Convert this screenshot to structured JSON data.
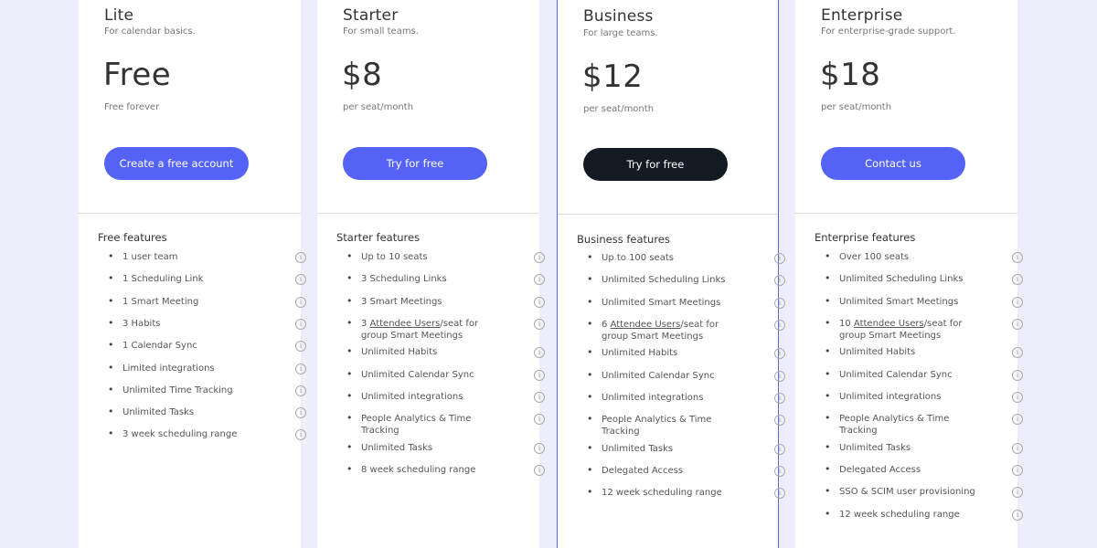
{
  "plans": [
    {
      "name": "Lite",
      "description": "For calendar basics.",
      "price": "Free",
      "billing": "Free forever",
      "cta": "Create a free account",
      "features_title": "Free features",
      "features": [
        "1 user team",
        "1 Scheduling Link",
        "1 Smart Meeting",
        "3 Habits",
        "1 Calendar Sync",
        "Limited integrations",
        "Unlimited Time Tracking",
        "Unlimited Tasks",
        "3 week scheduling range"
      ]
    },
    {
      "name": "Starter",
      "description": "For small teams.",
      "price": "$8",
      "billing": "per seat/month",
      "cta": "Try for free",
      "features_title": "Starter features",
      "features": [
        "Up to 10 seats",
        "3 Scheduling Links",
        "3 Smart Meetings",
        "3 Attendee Users/seat for group Smart Meetings",
        "Unlimited Habits",
        "Unlimited Calendar Sync",
        "Unlimited integrations",
        "People Analytics & Time Tracking",
        "Unlimited Tasks",
        "8 week scheduling range"
      ]
    },
    {
      "name": "Business",
      "description": "For large teams.",
      "price": "$12",
      "billing": "per seat/month",
      "cta": "Try for free",
      "features_title": "Business features",
      "features": [
        "Up to 100 seats",
        "Unlimited Scheduling Links",
        "Unlimited Smart Meetings",
        "6 Attendee Users/seat for group Smart Meetings",
        "Unlimited Habits",
        "Unlimited Calendar Sync",
        "Unlimited integrations",
        "People Analytics & Time Tracking",
        "Unlimited Tasks",
        "Delegated Access",
        "12 week scheduling range"
      ]
    },
    {
      "name": "Enterprise",
      "description": "For enterprise-grade support.",
      "price": "$18",
      "billing": "per seat/month",
      "cta": "Contact us",
      "features_title": "Enterprise features",
      "features": [
        "Over 100 seats",
        "Unlimited Scheduling Links",
        "Unlimited Smart Meetings",
        "10 Attendee Users/seat for group Smart Meetings",
        "Unlimited Habits",
        "Unlimited Calendar Sync",
        "Unlimited integrations",
        "People Analytics & Time Tracking",
        "Unlimited Tasks",
        "Delegated Access",
        "SSO & SCIM user provisioning",
        "12 week scheduling range"
      ]
    }
  ],
  "icons": {
    "info": "info-circle-icon",
    "bullet": "bullet-dot"
  },
  "colors": {
    "accent": "#5462f5",
    "dark_button": "#141a24",
    "highlight_border": "#5566ee",
    "background": "#eceefb"
  }
}
